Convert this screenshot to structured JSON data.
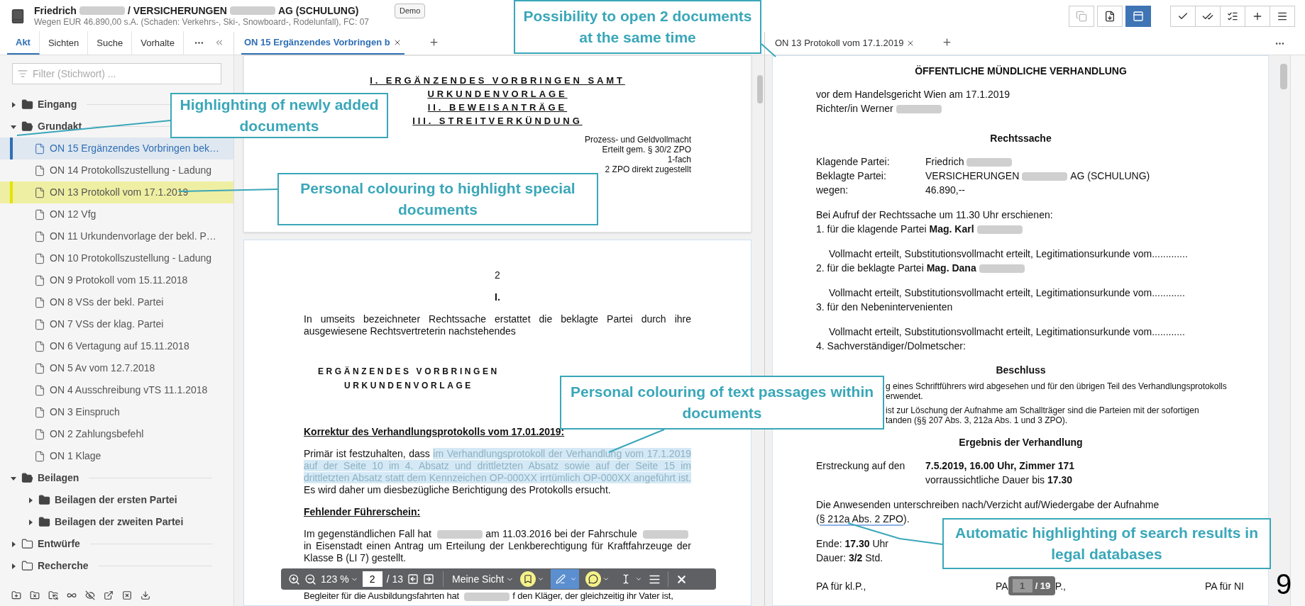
{
  "header": {
    "title": [
      {
        "kind": "text",
        "text": "Friedrich"
      },
      {
        "kind": "redacted"
      },
      {
        "kind": "text",
        "text": "/ VERSICHERUNGEN"
      },
      {
        "kind": "redacted"
      },
      {
        "kind": "text",
        "text": "AG (SCHULUNG)"
      }
    ],
    "subtitle": "Wegen EUR 46.890,00 s.A. (Schaden: Verkehrs-, Ski-, Snowboard-, Rodelunfall), FC: 07",
    "badge": "Demo"
  },
  "toolbar": {
    "groups": [
      [
        {
          "kind": "copy",
          "disabled": true,
          "selected": false
        },
        {
          "kind": "export",
          "disabled": false,
          "selected": false
        },
        {
          "kind": "layout",
          "disabled": false,
          "selected": true
        }
      ],
      [
        {
          "kind": "check",
          "disabled": false,
          "selected": false
        },
        {
          "kind": "checkone",
          "disabled": false,
          "selected": false
        },
        {
          "kind": "checkall",
          "disabled": false,
          "selected": false
        },
        {
          "kind": "add",
          "disabled": false,
          "selected": false
        },
        {
          "kind": "menu",
          "disabled": false,
          "selected": false
        }
      ]
    ]
  },
  "sidebar": {
    "tabs": [
      {
        "label": "Akt",
        "selected": true
      },
      {
        "label": "Sichten",
        "selected": false
      },
      {
        "label": "Suche",
        "selected": false
      },
      {
        "label": "Vorhalte",
        "selected": false
      }
    ],
    "filter": {
      "placeholder": "Filter (Stichwort) ..."
    },
    "tree": [
      {
        "kind": "folder",
        "label": "Eingang",
        "expanded": false,
        "filled": true
      },
      {
        "kind": "folder",
        "label": "Grundakt",
        "expanded": true,
        "filled": true,
        "children": [
          {
            "kind": "document",
            "label": "ON 15 Ergänzendes Vorbringen bek…",
            "new": true
          },
          {
            "kind": "document",
            "label": "ON 14 Protokollszustellung - Ladung",
            "new": false
          },
          {
            "kind": "document",
            "label": "ON 13 Protokoll vom 17.1.2019",
            "new": false,
            "color": "#e3e300"
          },
          {
            "kind": "document",
            "label": "ON 12 Vfg",
            "new": false
          },
          {
            "kind": "document",
            "label": "ON 11 Urkundenvorlage der bekl. P…",
            "new": false
          },
          {
            "kind": "document",
            "label": "ON 10 Protokollszustellung - Ladung",
            "new": false
          },
          {
            "kind": "document",
            "label": "ON 9 Protokoll vom 15.11.2018",
            "new": false
          },
          {
            "kind": "document",
            "label": "ON 8 VSs der bekl. Partei",
            "new": false
          },
          {
            "kind": "document",
            "label": "ON 7 VSs der klag. Partei",
            "new": false
          },
          {
            "kind": "document",
            "label": "ON 6 Vertagung auf 15.11.2018",
            "new": false
          },
          {
            "kind": "document",
            "label": "ON 5 Av vom 12.7.2018",
            "new": false
          },
          {
            "kind": "document",
            "label": "ON 4 Ausschreibung vTS 11.1.2018",
            "new": false
          },
          {
            "kind": "document",
            "label": "ON 3 Einspruch",
            "new": false
          },
          {
            "kind": "document",
            "label": "ON 2 Zahlungsbefehl",
            "new": false
          },
          {
            "kind": "document",
            "label": "ON 1 Klage",
            "new": false
          }
        ]
      },
      {
        "kind": "folder",
        "label": "Beilagen",
        "expanded": true,
        "filled": true,
        "children": [
          {
            "kind": "folder",
            "label": "Beilagen der ersten Partei",
            "expanded": false,
            "filled": true
          },
          {
            "kind": "folder",
            "label": "Beilagen der zweiten Partei",
            "expanded": false,
            "filled": true
          }
        ]
      },
      {
        "kind": "folder",
        "label": "Entwürfe",
        "expanded": false,
        "filled": false
      },
      {
        "kind": "folder",
        "label": "Recherche",
        "expanded": false,
        "filled": false
      }
    ]
  },
  "left_pane": {
    "tabs": [
      {
        "label": "ON 15 Ergänzendes Vorbringen b",
        "selected": true
      }
    ],
    "pages": [
      {
        "kind": "cover",
        "headings": [
          "I. ERGÄNZENDES VORBRINGEN SAMT",
          "URKUNDENVORLAGE",
          "II. BEWEISANTRÄGE",
          "III. STREITVERKÜNDUNG"
        ],
        "notes": [
          "Prozess- und Geldvollmacht",
          "Erteilt gem. § 30/2 ZPO",
          "1-fach",
          "2 ZPO direkt zugestellt"
        ]
      },
      {
        "kind": "body",
        "blocks": [
          {
            "kind": "page_number",
            "text": "2"
          },
          {
            "kind": "heading",
            "text": "I."
          },
          {
            "kind": "paragraph",
            "segments": [
              {
                "kind": "text",
                "text": "In umseits bezeichneter Rechtssache erstattet die beklagte Partei durch ihre ausgewiesene Rechtsvertreterin nachstehendes",
                "highlighted": false
              }
            ]
          },
          {
            "kind": "spaced_heading",
            "lines": [
              "ERGÄNZENDES VORBRINGEN",
              "URKUNDENVORLAGE"
            ]
          },
          {
            "kind": "subheading",
            "text": "Korrektur des Verhandlungsprotokolls vom 17.01.2019:"
          },
          {
            "kind": "paragraph",
            "segments": [
              {
                "kind": "text",
                "text": "Primär ist festzuhalten, dass ",
                "highlighted": false
              },
              {
                "kind": "text",
                "text": "im Verhandlungsprotokoll der Verhandlung vom 17.1.2019 auf der Seite 10 im 4. Absatz und drittletzten Absatz sowie auf der Seite 15 im drittletzten Absatz statt dem Kennzeichen OP-000XX irrtümlich OP-000XX angeführt ist.",
                "highlighted": true
              },
              {
                "kind": "text",
                "text": " Es wird daher um diesbezügliche Berichtigung des Protokolls ersucht.",
                "highlighted": false
              }
            ]
          },
          {
            "kind": "subheading",
            "text": "Fehlender Führerschein:"
          },
          {
            "kind": "paragraph",
            "segments": [
              {
                "kind": "text",
                "text": "Im gegenständlichen Fall hat",
                "highlighted": false
              },
              {
                "kind": "redacted"
              },
              {
                "kind": "text",
                "text": "am 11.03.2016 bei der Fahrschule",
                "highlighted": false
              },
              {
                "kind": "redacted"
              },
              {
                "kind": "text",
                "text": "in Eisenstadt einen Antrag um Erteilung der Lenkberechtigung für Kraftfahrzeuge der Klasse B (LI 7) gestellt.",
                "highlighted": false
              }
            ]
          },
          {
            "kind": "line",
            "segments": [
              {
                "kind": "text",
                "text": "Begleiter für die Ausbildungsfahrten hat",
                "highlighted": false
              },
              {
                "kind": "redacted"
              },
              {
                "kind": "text",
                "text": "f den Kläger, der gleichzeitig ihr Vater ist,",
                "highlighted": false
              }
            ]
          }
        ]
      }
    ],
    "viewer_toolbar": {
      "zoom": "123 %",
      "page": "2",
      "page_total": "/ 13",
      "view": "Meine Sicht",
      "tools": [
        {
          "kind": "bookmark",
          "selected": false
        },
        {
          "kind": "pen",
          "selected": true
        },
        {
          "kind": "comment",
          "selected": false
        },
        {
          "kind": "cursor",
          "selected": false
        }
      ]
    }
  },
  "right_pane": {
    "tabs": [
      {
        "label": "ON 13 Protokoll vom 17.1.2019",
        "selected": false
      }
    ],
    "blocks": [
      {
        "kind": "title",
        "text": "ÖFFENTLICHE MÜNDLICHE VERHANDLUNG"
      },
      {
        "kind": "para",
        "lines": [
          {
            "indent": false,
            "segments": [
              {
                "kind": "text",
                "text": "vor dem Handelsgericht Wien  am 17.1.2019"
              }
            ]
          },
          {
            "indent": false,
            "segments": [
              {
                "kind": "text",
                "text": "Richter/in Werner"
              },
              {
                "kind": "redacted"
              }
            ]
          }
        ]
      },
      {
        "kind": "section",
        "text": "Rechtssache"
      },
      {
        "kind": "table",
        "rows": [
          {
            "label": "Klagende Partei:",
            "lines": [
              [
                {
                  "kind": "text",
                  "text": "Friedrich"
                },
                {
                  "kind": "redacted"
                }
              ]
            ]
          },
          {
            "label": "Beklagte Partei:",
            "lines": [
              [
                {
                  "kind": "text",
                  "text": "VERSICHERUNGEN"
                },
                {
                  "kind": "redacted"
                },
                {
                  "kind": "text",
                  "text": "AG (SCHULUNG)"
                }
              ]
            ]
          },
          {
            "label": "wegen:",
            "lines": [
              [
                {
                  "kind": "text",
                  "text": "46.890,--"
                }
              ]
            ]
          }
        ]
      },
      {
        "kind": "para",
        "lines": [
          {
            "indent": false,
            "segments": [
              {
                "kind": "text",
                "text": "Bei Aufruf der Rechtssache um 11.30 Uhr erschienen:"
              }
            ]
          },
          {
            "indent": false,
            "segments": [
              {
                "kind": "text",
                "text": "1. für die klagende Partei **Mag. Karl**"
              },
              {
                "kind": "redacted"
              }
            ]
          }
        ]
      },
      {
        "kind": "para",
        "lines": [
          {
            "indent": true,
            "segments": [
              {
                "kind": "text",
                "text": "Vollmacht erteilt, Substitutionsvollmacht erteilt, Legitimationsurkunde vom............."
              }
            ]
          },
          {
            "indent": false,
            "segments": [
              {
                "kind": "text",
                "text": "2. für die beklagte Partei **Mag. Dana**"
              },
              {
                "kind": "redacted"
              }
            ]
          }
        ]
      },
      {
        "kind": "para",
        "lines": [
          {
            "indent": true,
            "segments": [
              {
                "kind": "text",
                "text": "Vollmacht erteilt, Substitutionsvollmacht erteilt, Legitimationsurkunde vom............"
              }
            ]
          },
          {
            "indent": false,
            "segments": [
              {
                "kind": "text",
                "text": "3. für den Nebenintervenienten"
              }
            ]
          }
        ]
      },
      {
        "kind": "para",
        "lines": [
          {
            "indent": true,
            "segments": [
              {
                "kind": "text",
                "text": "Vollmacht erteilt, Substitutionsvollmacht erteilt, Legitimationsurkunde vom............"
              }
            ]
          },
          {
            "indent": false,
            "segments": [
              {
                "kind": "text",
                "text": "4. Sachverständiger/Dolmetscher:"
              }
            ]
          }
        ]
      },
      {
        "kind": "section",
        "text": "Beschluss"
      },
      {
        "kind": "fragment",
        "lines": [
          "g eines Schriftführers wird abgesehen und für den übrigen Teil des Verhandlungsprotokolls",
          "erwendet."
        ]
      },
      {
        "kind": "fragment",
        "lines": [
          "ist zur Löschung der Aufnahme am Schallträger sind die Parteien mit der sofortigen",
          "tanden (§§ 207 Abs. 3, 212a Abs. 1 und 3 ZPO)."
        ]
      },
      {
        "kind": "section",
        "text": "Ergebnis der Verhandlung"
      },
      {
        "kind": "table",
        "rows": [
          {
            "label": "Erstreckung auf den",
            "lines": [
              [
                {
                  "kind": "text",
                  "text": "**7.5.2019,  16.00 Uhr, Zimmer 171**"
                }
              ],
              [
                {
                  "kind": "text",
                  "text": "vorraussichtliche Dauer bis **17.30**"
                }
              ]
            ]
          }
        ]
      },
      {
        "kind": "para",
        "lines": [
          {
            "indent": false,
            "segments": [
              {
                "kind": "text",
                "text": "Die Anwesenden unterschreiben nach/Verzicht auf/Wiedergabe der Aufnahme"
              }
            ]
          },
          {
            "indent": false,
            "segments": [
              {
                "kind": "text",
                "text": "("
              },
              {
                "kind": "link",
                "text": "§ 212a Abs. 2 ZPO"
              },
              {
                "kind": "text",
                "text": ")."
              }
            ]
          }
        ]
      },
      {
        "kind": "para",
        "lines": [
          {
            "indent": false,
            "segments": [
              {
                "kind": "text",
                "text": "Ende: **17.30** Uhr"
              }
            ]
          },
          {
            "indent": false,
            "segments": [
              {
                "kind": "text",
                "text": "Dauer: **3/2** Std."
              }
            ]
          }
        ]
      },
      {
        "kind": "signatures",
        "items": [
          "PA für kl.P.,",
          "PA",
          "P.,",
          "PA für NI"
        ]
      }
    ],
    "page_indicator": {
      "page": "1",
      "total": "/ 19"
    }
  },
  "callouts": [
    {
      "text": "Possibility to open 2 documents at the same time"
    },
    {
      "text": "Highlighting of newly added documents"
    },
    {
      "text": "Personal colouring to highlight special documents"
    },
    {
      "text": "Personal colouring of text passages within documents"
    },
    {
      "text": "Automatic highlighting of search results in legal databases"
    }
  ],
  "slide_number": "9"
}
